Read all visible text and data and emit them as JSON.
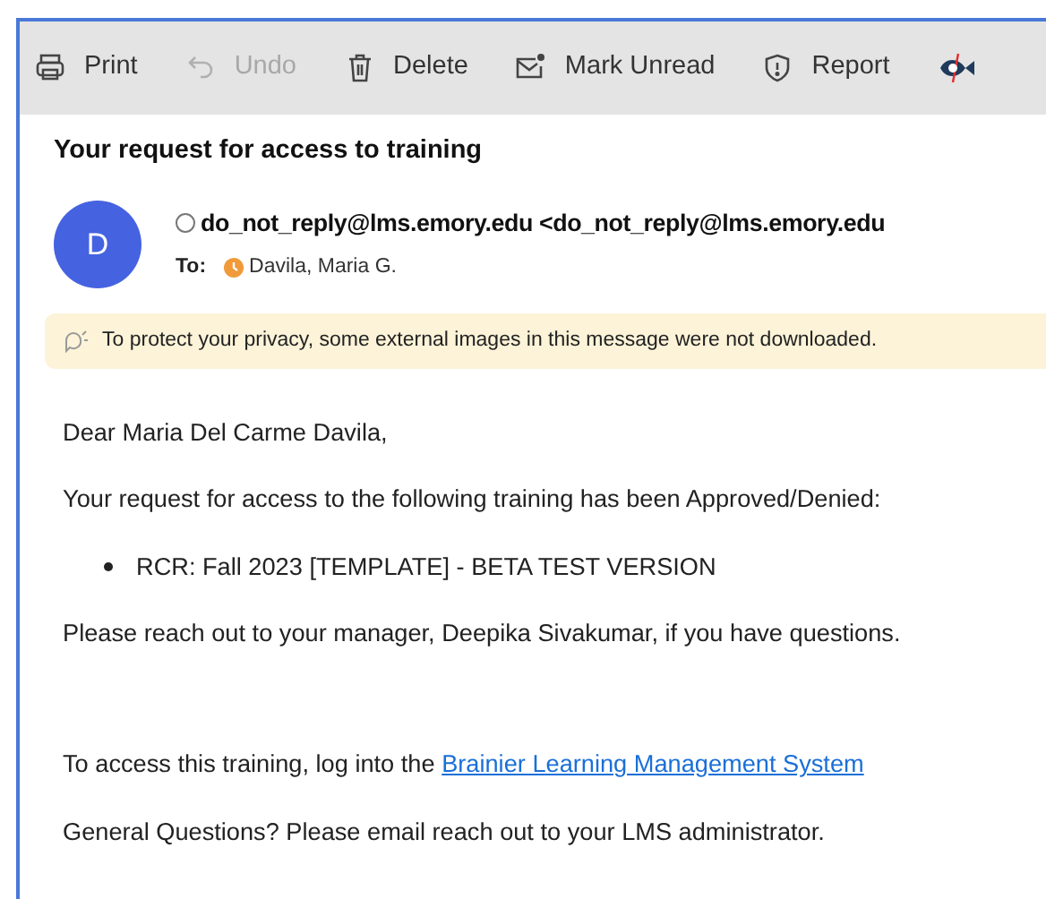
{
  "toolbar": [
    {
      "kind": "print",
      "label": "Print",
      "disabled": false
    },
    {
      "kind": "undo",
      "label": "Undo",
      "disabled": true
    },
    {
      "kind": "delete",
      "label": "Delete",
      "disabled": false
    },
    {
      "kind": "unread",
      "label": "Mark Unread",
      "disabled": false
    },
    {
      "kind": "report",
      "label": "Report",
      "disabled": false
    },
    {
      "kind": "phish",
      "disabled": false
    }
  ],
  "message": {
    "subject": "Your request for access to training",
    "avatar": "D",
    "sender": "do_not_reply@lms.emory.edu <do_not_reply@lms.emory.edu",
    "to_label": "To:",
    "recipient": "Davila, Maria G.",
    "privacy_notice": "To protect your privacy, some external images in this message were not downloaded.",
    "body": [
      {
        "kind": "para",
        "text": "Dear Maria Del Carme Davila,"
      },
      {
        "kind": "para",
        "text": "Your request for access to the following training has been Approved/Denied:"
      },
      {
        "kind": "bullet",
        "text": "RCR: Fall 2023 [TEMPLATE] - BETA TEST VERSION"
      },
      {
        "kind": "para",
        "text": "Please reach out to your manager, Deepika Sivakumar, if you have questions."
      },
      {
        "kind": "gap"
      },
      {
        "kind": "link_para",
        "text": "To access this training, log into the",
        "link": "Brainier Learning Management System"
      },
      {
        "kind": "para",
        "text": "General Questions? Please email reach out to your LMS administrator."
      }
    ]
  }
}
